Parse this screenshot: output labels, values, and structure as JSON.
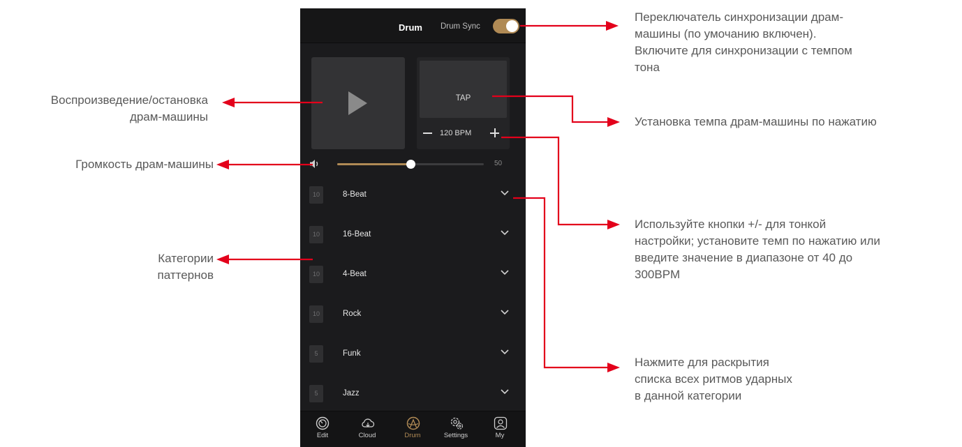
{
  "app": {
    "title": "Drum",
    "drum_sync_label": "Drum Sync",
    "drum_sync_on": true,
    "accent_color": "#b08a55"
  },
  "tap": {
    "label": "TAP",
    "bpm": "120 BPM"
  },
  "volume": {
    "value": "50",
    "level_percent": 50
  },
  "categories": [
    {
      "count": "10",
      "name": "8-Beat"
    },
    {
      "count": "10",
      "name": "16-Beat"
    },
    {
      "count": "10",
      "name": "4-Beat"
    },
    {
      "count": "10",
      "name": "Rock"
    },
    {
      "count": "5",
      "name": "Funk"
    },
    {
      "count": "5",
      "name": "Jazz"
    }
  ],
  "nav": {
    "items": [
      {
        "label": "Edit",
        "icon": "edit-dial-icon"
      },
      {
        "label": "Cloud",
        "icon": "cloud-download-icon"
      },
      {
        "label": "Drum",
        "icon": "drum-icon"
      },
      {
        "label": "Settings",
        "icon": "settings-gear-icon"
      },
      {
        "label": "My",
        "icon": "user-icon"
      }
    ],
    "active": "Drum"
  },
  "annotations": {
    "drum_sync_lines": [
      "Переключатель синхронизации драм-",
      "машины  (по умочанию включен).",
      "Включите для синхронизации с темпом",
      "тона"
    ],
    "tap_line": "Установка темпа драм-машины по нажатию",
    "bpm_lines": [
      "Используйте кнопки +/- для тонкой",
      "настройки; установите темп по нажатию или",
      "введите значение в диапазоне от 40 до",
      "300BPM"
    ],
    "expand_lines": [
      "Нажмите для раскрытия",
      "списка всех ритмов ударных",
      "в данной категории"
    ],
    "play_lines": [
      "Воспроизведение/остановка",
      "драм-машины"
    ],
    "volume_line": "Громкость драм-машины",
    "categories_lines": [
      "Категории",
      "паттернов"
    ],
    "arrow_color": "#e3001b"
  }
}
